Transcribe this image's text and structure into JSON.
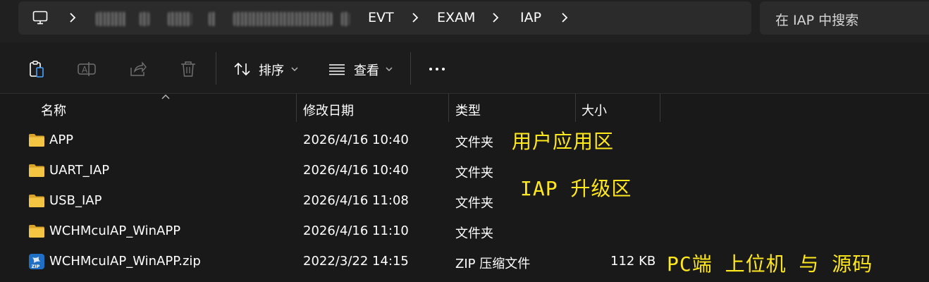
{
  "address_bar": {
    "crumbs": [
      "EVT",
      "EXAM",
      "IAP"
    ]
  },
  "search": {
    "placeholder": "在 IAP 中搜索"
  },
  "toolbar": {
    "sort_label": "排序",
    "view_label": "查看"
  },
  "columns": {
    "name": "名称",
    "modified": "修改日期",
    "type": "类型",
    "size": "大小"
  },
  "files": [
    {
      "name": "APP",
      "modified": "2026/4/16 10:40",
      "type": "文件夹",
      "size": "",
      "icon": "folder-icon"
    },
    {
      "name": "UART_IAP",
      "modified": "2026/4/16 10:40",
      "type": "文件夹",
      "size": "",
      "icon": "folder-icon"
    },
    {
      "name": "USB_IAP",
      "modified": "2026/4/16 11:08",
      "type": "文件夹",
      "size": "",
      "icon": "folder-icon"
    },
    {
      "name": "WCHMcuIAP_WinAPP",
      "modified": "2026/4/16 11:10",
      "type": "文件夹",
      "size": "",
      "icon": "folder-icon"
    },
    {
      "name": "WCHMcuIAP_WinAPP.zip",
      "modified": "2022/3/22 14:15",
      "type": "ZIP 压缩文件",
      "size": "112 KB",
      "icon": "zip-icon"
    }
  ],
  "annotations": {
    "app_area": "用户应用区",
    "iap_area": "IAP 升级区",
    "pc_tool": "PC端 上位机 与 源码"
  },
  "colors": {
    "background": "#191919",
    "folder": "#f4c443",
    "annotation": "#ffe81c",
    "zip_badge": "#1f6fc4"
  }
}
